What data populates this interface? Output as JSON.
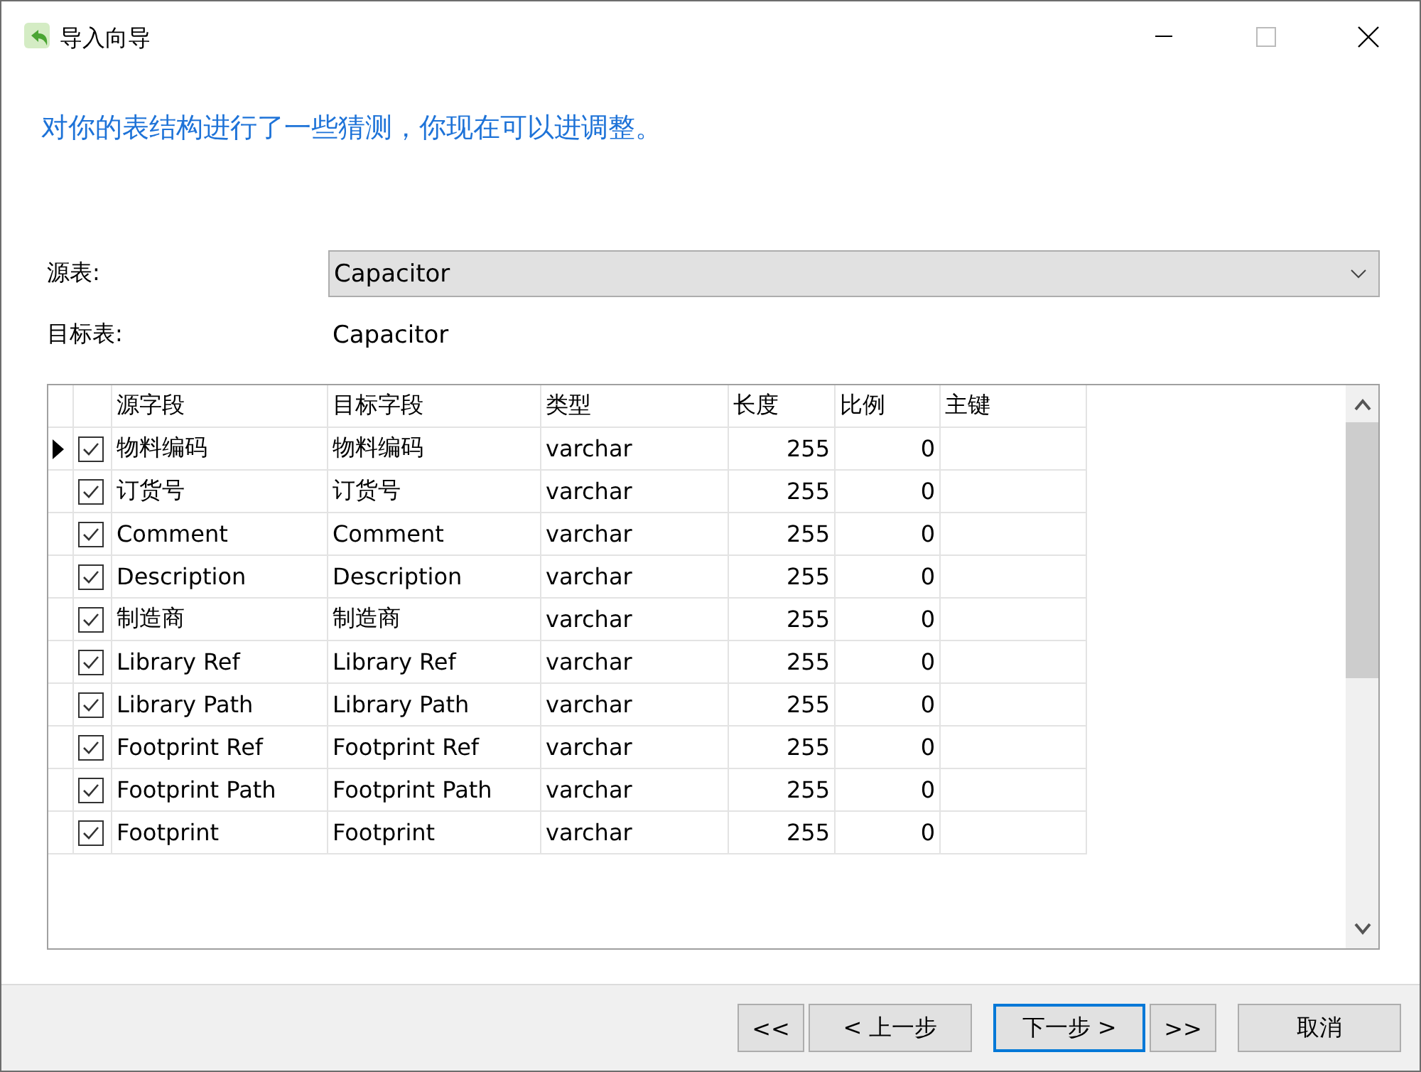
{
  "window": {
    "title": "导入向导"
  },
  "heading": "对你的表结构进行了一些猜测，你现在可以进调整。",
  "source_table": {
    "label": "源表:",
    "value": "Capacitor"
  },
  "target_table": {
    "label": "目标表:",
    "value": "Capacitor"
  },
  "table": {
    "columns": [
      "源字段",
      "目标字段",
      "类型",
      "长度",
      "比例",
      "主键"
    ],
    "rows": [
      {
        "selected": true,
        "checked": true,
        "source": "物料编码",
        "target": "物料编码",
        "type": "varchar",
        "length": "255",
        "scale": "0"
      },
      {
        "selected": false,
        "checked": true,
        "source": "订货号",
        "target": "订货号",
        "type": "varchar",
        "length": "255",
        "scale": "0"
      },
      {
        "selected": false,
        "checked": true,
        "source": "Comment",
        "target": "Comment",
        "type": "varchar",
        "length": "255",
        "scale": "0"
      },
      {
        "selected": false,
        "checked": true,
        "source": "Description",
        "target": "Description",
        "type": "varchar",
        "length": "255",
        "scale": "0"
      },
      {
        "selected": false,
        "checked": true,
        "source": "制造商",
        "target": "制造商",
        "type": "varchar",
        "length": "255",
        "scale": "0"
      },
      {
        "selected": false,
        "checked": true,
        "source": "Library Ref",
        "target": "Library Ref",
        "type": "varchar",
        "length": "255",
        "scale": "0"
      },
      {
        "selected": false,
        "checked": true,
        "source": "Library Path",
        "target": "Library Path",
        "type": "varchar",
        "length": "255",
        "scale": "0"
      },
      {
        "selected": false,
        "checked": true,
        "source": "Footprint Ref",
        "target": "Footprint Ref",
        "type": "varchar",
        "length": "255",
        "scale": "0"
      },
      {
        "selected": false,
        "checked": true,
        "source": "Footprint Path",
        "target": "Footprint Path",
        "type": "varchar",
        "length": "255",
        "scale": "0"
      },
      {
        "selected": false,
        "checked": true,
        "source": "Footprint",
        "target": "Footprint",
        "type": "varchar",
        "length": "255",
        "scale": "0"
      }
    ]
  },
  "buttons": [
    {
      "label": "<<",
      "default": false
    },
    {
      "label": "< 上一步",
      "default": false
    },
    {
      "label": "下一步 >",
      "default": true
    },
    {
      "label": ">>",
      "default": false
    },
    {
      "label": "取消",
      "default": false
    }
  ]
}
